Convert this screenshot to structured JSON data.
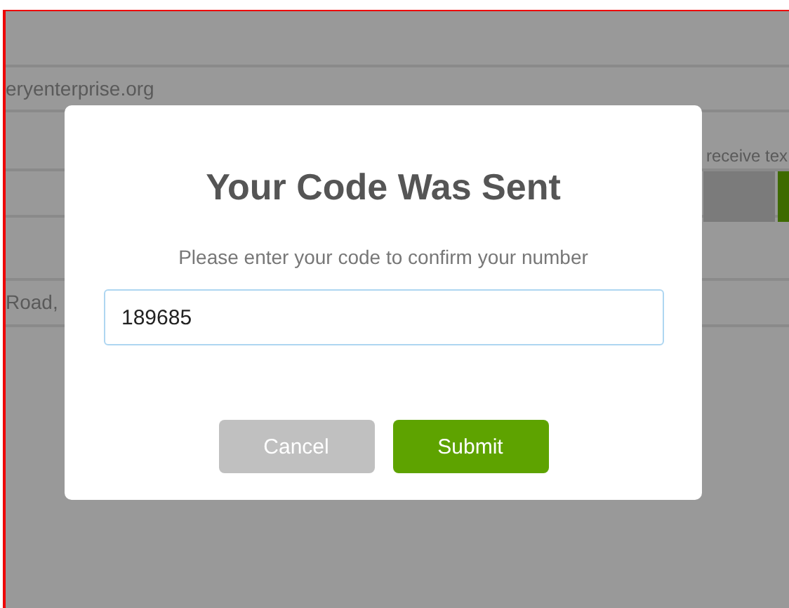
{
  "background": {
    "email_fragment": "eryenterprise.org",
    "notice_fragment": "receive tex",
    "address_fragment": "Road,"
  },
  "dialog": {
    "title": "Your Code Was Sent",
    "message": "Please enter your code to confirm your number",
    "code_field": {
      "value": "189685",
      "focused": true
    },
    "buttons": [
      {
        "label": "Cancel",
        "kind": "secondary"
      },
      {
        "label": "Submit",
        "kind": "primary"
      }
    ]
  }
}
